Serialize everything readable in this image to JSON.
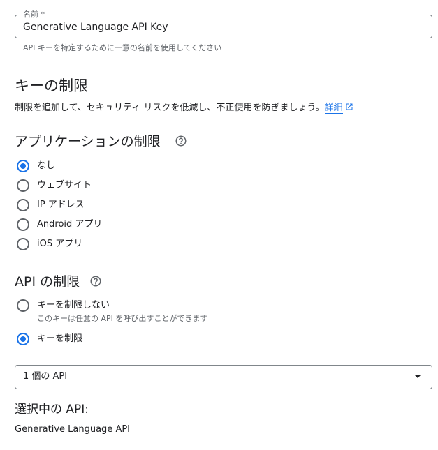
{
  "name_field": {
    "label": "名前 *",
    "value": "Generative Language API Key",
    "hint": "API キーを特定するために一意の名前を使用してください"
  },
  "key_restrictions": {
    "title": "キーの制限",
    "description": "制限を追加して、セキュリティ リスクを低減し、不正使用を防ぎましょう。",
    "link_label": "詳細",
    "link_icon": "open-in-new-icon"
  },
  "app_restrictions": {
    "title": "アプリケーションの制限",
    "help_icon": "help-circle-icon",
    "options": [
      {
        "label": "なし",
        "selected": true
      },
      {
        "label": "ウェブサイト",
        "selected": false
      },
      {
        "label": "IP アドレス",
        "selected": false
      },
      {
        "label": "Android アプリ",
        "selected": false
      },
      {
        "label": "iOS アプリ",
        "selected": false
      }
    ]
  },
  "api_restrictions": {
    "title": "API の制限",
    "help_icon": "help-circle-icon",
    "options": [
      {
        "label": "キーを制限しない",
        "sublabel": "このキーは任意の API を呼び出すことができます",
        "selected": false
      },
      {
        "label": "キーを制限",
        "selected": true
      }
    ],
    "select_value": "1 個の API",
    "selected_heading": "選択中の API:",
    "selected_apis": [
      "Generative Language API"
    ]
  },
  "colors": {
    "accent": "#1a73e8",
    "text": "#202124",
    "secondary_text": "#5f6368",
    "border": "#80868b"
  }
}
